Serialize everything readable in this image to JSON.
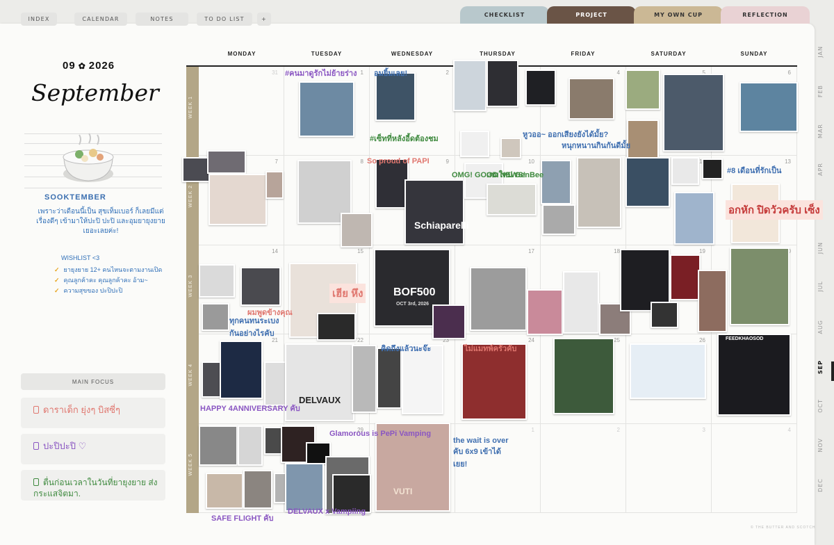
{
  "nav": {
    "buttons": [
      "INDEX",
      "CALENDAR",
      "NOTES",
      "TO DO LIST",
      "+"
    ],
    "sections": [
      {
        "label": "CHECKLIST",
        "color": "#b8c8cc"
      },
      {
        "label": "PROJECT",
        "color": "#6a5446"
      },
      {
        "label": "MY OWN CUP",
        "color": "#cbb895"
      },
      {
        "label": "REFLECTION",
        "color": "#e9d2d4"
      }
    ]
  },
  "months": [
    "JAN",
    "FEB",
    "MAR",
    "APR",
    "MAY",
    "JUN",
    "JUL",
    "AUG",
    "SEP",
    "OCT",
    "NOV",
    "DEC"
  ],
  "active_month": "SEP",
  "left": {
    "date_month": "09",
    "date_year": "2026",
    "month_name": "September",
    "sticker_title": "SOOKTEMBER",
    "note": "เพราะว่าเดือนนี้เป็น สุขเท็มเบอร์ ก็เลยมีแต่เรื่องดีๆ เข้ามาให้ปะปิ ปะปิ และอุมยายุงยายเยอะเลยค่ะ!",
    "wishlist_title": "WISHLIST <3",
    "wishlist": [
      "ยายุงยาย 12+ คนไหนจะตามงานเปิด",
      "คุณลูกค้าคะ คุณลูกค้าคะ อ้าม~",
      "ความสุขของ ปะปิปะปิ"
    ],
    "focus_title": "MAIN FOCUS",
    "focus_items": [
      {
        "text": "ดาราเด็ก ยุ่งๆ บิสซี่ๆ",
        "color": "#e0776f"
      },
      {
        "text": "ปะปิปะปิ ♡",
        "color": "#8a56c2"
      },
      {
        "text": "ตื่นก่อนเวลาในวันที่ยายุงยาย ส่งกระแสจิตมา.",
        "color": "#3f8a3f"
      }
    ]
  },
  "calendar": {
    "weekdays": [
      "MONDAY",
      "TUESDAY",
      "WEDNESDAY",
      "THURSDAY",
      "FRIDAY",
      "SATURDAY",
      "SUNDAY"
    ],
    "weeks": [
      "WEEK 1",
      "WEEK 2",
      "WEEK 3",
      "WEEK 4",
      "WEEK 5"
    ],
    "days": [
      [
        "31",
        "1",
        "2",
        "3",
        "4",
        "5",
        "6"
      ],
      [
        "7",
        "8",
        "9",
        "10",
        "11",
        "12",
        "13"
      ],
      [
        "14",
        "15",
        "16",
        "17",
        "18",
        "19",
        "20"
      ],
      [
        "21",
        "22",
        "23",
        "24",
        "25",
        "26",
        "27"
      ],
      [
        "28",
        "29",
        "30",
        "1",
        "2",
        "3",
        "4"
      ]
    ],
    "scribbles": [
      {
        "text": "#คนมาดูรักไม่ย้ายร่าง",
        "color": "#8a56c2"
      },
      {
        "text": "อมยิ้มเลย!",
        "color": "#3f6fb0"
      },
      {
        "text": "#เซ็ทที่หลังอี้ดต้องชม",
        "color": "#3f8a3f"
      },
      {
        "text": "หูวออ~ ออกเสียงยังได้มั้ย?",
        "color": "#3f6fb0"
      },
      {
        "text": "หนุกหนานกินกันดีมั้ย",
        "color": "#3f6fb0"
      },
      {
        "text": "#8 เดือนที่รักเป็น",
        "color": "#3f6fb0"
      },
      {
        "text": "OMG! GOOD NEWS!",
        "color": "#3f8a3f"
      },
      {
        "text": "So proud of PAPI",
        "color": "#e0776f"
      },
      {
        "text": "เกมใหม่ GenBee",
        "color": "#3f8a3f"
      },
      {
        "text": "อกหัก ปิดวัวครับ เซ็ง",
        "color": "#c53a3a"
      },
      {
        "text": "เฮีย หึง",
        "color": "#e0776f"
      },
      {
        "text": "ทุกคนทนระเบงกันอย่างไรคับ",
        "color": "#3f6fb0"
      },
      {
        "text": "คิดถึงแล้วนะจ๊ะ",
        "color": "#3f6fb0"
      },
      {
        "text": "ไม่แมทพ์ครัวคับ",
        "color": "#e0776f"
      },
      {
        "text": "HAPPY 4ANNIVERSARY คับ",
        "color": "#8a56c2"
      },
      {
        "text": "Glamorous is PePi Vamping",
        "color": "#8a56c2"
      },
      {
        "text": "the wait is over คับ 6x9 เข้าได้เยย!",
        "color": "#3f6fb0"
      },
      {
        "text": "SAFE FLIGHT คับ",
        "color": "#8a56c2"
      },
      {
        "text": "DELVAUX x Vampiing",
        "color": "#8a56c2"
      },
      {
        "text": "ผมพูดข้างคุณ",
        "color": "#e0776f"
      }
    ],
    "poster_texts": {
      "schiaparelli": "Schiaparelli",
      "bof500": "BOF500",
      "bof500_date": "OCT 3rd, 2026",
      "delvaux": "DELVAUX",
      "feed": "FEEDKHAOSOD",
      "vuti": "VUTI"
    }
  },
  "watermark": "© THE BUTTER AND SCOTCH"
}
